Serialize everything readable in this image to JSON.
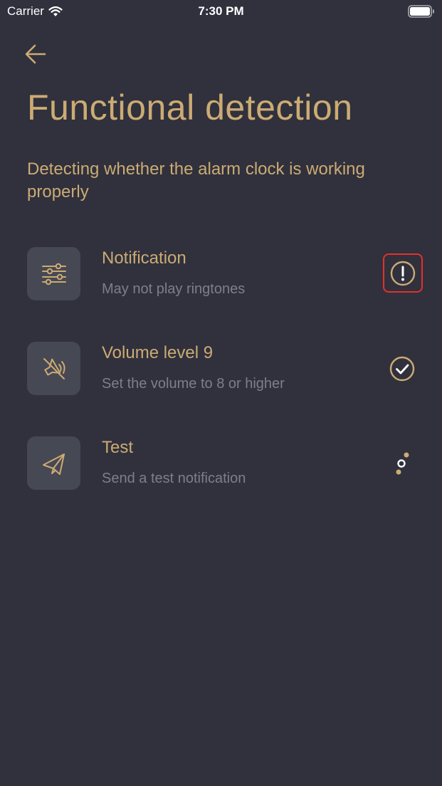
{
  "status_bar": {
    "carrier": "Carrier",
    "time": "7:30 PM"
  },
  "page": {
    "title": "Functional detection",
    "subtitle": "Detecting whether the alarm clock is working properly"
  },
  "checks": [
    {
      "title": "Notification",
      "description": "May not play ringtones",
      "icon": "sliders-icon",
      "status": "warning"
    },
    {
      "title": "Volume level 9",
      "description": "Set the volume to 8 or higher",
      "icon": "speaker-muted-icon",
      "status": "ok"
    },
    {
      "title": "Test",
      "description": "Send a test notification",
      "icon": "paper-plane-icon",
      "status": "loading"
    }
  ],
  "colors": {
    "background": "#30313d",
    "accent": "#ccab73",
    "card": "#464854",
    "muted_text": "#7d7f88",
    "warning_outline": "#e5302a"
  }
}
